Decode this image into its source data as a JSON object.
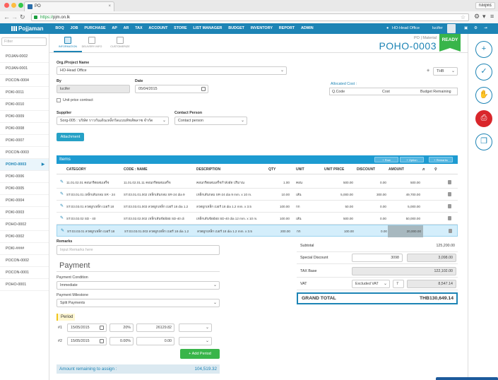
{
  "browser": {
    "tab_title": "PO",
    "user_chip": "กลยุทธ",
    "address_scheme": "https://",
    "address_rest": "pjm.on.lk"
  },
  "nav": {
    "logo": "Pojjaman",
    "menu": [
      "BOQ",
      "JOB",
      "PURCHASE",
      "AP",
      "AR",
      "TAX",
      "ACCOUNT",
      "STORE",
      "LIST MANAGER",
      "BUDGET",
      "INVENTORY",
      "REPORT",
      "ADMIN"
    ],
    "office": "HO-Head Office",
    "user": "lucifer"
  },
  "left": {
    "filter_placeholder": "Filter",
    "items": [
      "POJAN-0002",
      "POJAN-0001",
      "POCON-0004",
      "POKI-0011",
      "POKI-0010",
      "POKI-0009",
      "POKI-0008",
      "POKI-0007",
      "POCON-0003",
      "POHO-0003",
      "POKI-0006",
      "POKI-0005",
      "POKI-0004",
      "POKI-0003",
      "POHO-0002",
      "POKI-0002",
      "POKI-####",
      "POCON-0002",
      "POCON-0001",
      "POHO-0001"
    ],
    "active_index": 9
  },
  "top_tabs": [
    "INFORMATION",
    "DELIVERY INFO",
    "CUSTOMERIZE"
  ],
  "doc": {
    "type": "PO | Material",
    "number": "POHO-0003",
    "status": "READY"
  },
  "form": {
    "org_label": "Org./Project Name",
    "org_value": "HO-Head Office",
    "by_label": "By",
    "by_value": "lucifer",
    "date_label": "Date",
    "date_value": "05/04/2015",
    "currency": "THB",
    "unit_price_contract": "Unit price contract",
    "allocated_cost_label": "Allocated Cost :",
    "alloc_cols": [
      "Q.Code",
      "Cost",
      "Budget Remaining"
    ],
    "supplier_label": "Supplier",
    "supplier_value": "Sorg-005 : บริษัท ราวกันเดินเหล็กริดแบบทิชส์พลาซ จำกัด",
    "contact_label": "Contact Person",
    "contact_placeholder": "Contact person",
    "attachment_btn": "Attachment"
  },
  "items": {
    "title": "Items",
    "buttons": [
      "+ Row",
      "+ Option",
      "+ Remarks"
    ],
    "columns": [
      "CATEGORY",
      "CODE : NAME",
      "DESCRIPTION",
      "QTY",
      "UNIT",
      "UNIT PRICE",
      "DISCOUNT",
      "AMOUNT",
      "ภ"
    ],
    "rows": [
      {
        "cat": "11.01.02.01 คอนกรีตผสมเสร็จ",
        "code": "11.01.02.01.11 คอนกรีตผสมเสร็จ",
        "desc": "คอนกรีตผสมเสร็จกำลังอัด ปริมาณ",
        "qty": "1.00",
        "unit": "คอน",
        "price": "500.00",
        "disc": "0.00",
        "amt": "500.00"
      },
      {
        "cat": "ST.03.01.01 เหล็กเส้นกลม SR - 24",
        "code": "ST.03.01.01.002 เหล็กเส้นกลม SR-24 dia 9",
        "desc": "เหล็กเส้นกลม SR-24 dia 9 mm. x 10 m.",
        "qty": "10.00",
        "unit": "เส้น",
        "price": "5,000.00",
        "disc": "300.00",
        "amt": "49,700.00"
      },
      {
        "cat": "ST.03.03.01 ลวดผูกเหล็ก เบอร์ 18",
        "code": "ST.03.03.01.003 ลวดผูกเหล็ก เบอร์ 18 dia 1.2",
        "desc": "ลวดผูกเหล็ก เบอร์ 18 dia 1.2 mm. x 3.5",
        "qty": "100.00",
        "unit": "กก",
        "price": "50.00",
        "disc": "0.00",
        "amt": "5,000.00"
      },
      {
        "cat": "ST.03.02.02 SD - 40",
        "code": "ST.03.02.02.002 เหล็กเส้นข้ออ้อย SD-40 di",
        "desc": "เหล็กเส้นข้ออ้อย SD-40 dia 12 mm. x 10 m.",
        "qty": "100.00",
        "unit": "เส้น",
        "price": "500.00",
        "disc": "0.00",
        "amt": "50,000.00"
      },
      {
        "cat": "ST.03.03.01 ลวดผูกเหล็ก เบอร์ 18",
        "code": "ST.03.03.01.003 ลวดผูกเหล็ก เบอร์ 18 dia 1.2",
        "desc": "ลวดผูกเหล็ก เบอร์ 18 dia 1.2 mm. x 3.5",
        "qty": "200.00",
        "unit": "กก",
        "price": "100.00",
        "disc": "0.00",
        "amt": "20,000.00"
      }
    ],
    "selected_row": 4
  },
  "remarks": {
    "label": "Remarks",
    "placeholder": "Input Remarks here"
  },
  "payment": {
    "title": "Payment",
    "condition_label": "Payment Condition",
    "condition_value": "Immediate",
    "milestone_label": "Payment Milestone",
    "milestone_value": "Split Payments",
    "period_label": "Period",
    "periods": [
      {
        "no": "#1",
        "date": "15/05/2015",
        "pct": "20%",
        "amount": "26129.82"
      },
      {
        "no": "#2",
        "date": "15/05/2015",
        "pct": "0.00%",
        "amount": "0.00"
      }
    ],
    "add_period": "+ Add Period",
    "remaining_label": "Amount remaining to assign :",
    "remaining_value": "104,519.32"
  },
  "totals": {
    "subtotal_label": "Subtotal",
    "subtotal": "125,200.00",
    "discount_label": "Special Discount",
    "discount_input": "3098",
    "discount": "3,098.00",
    "taxbase_label": "TAX Base",
    "taxbase": "122,102.00",
    "vat_label": "VAT",
    "vat_mode": "Excluded VAT",
    "vat_rate": "7",
    "vat": "8,547.14",
    "grand_label": "GRAND TOTAL",
    "grand": "THB130,649.14"
  }
}
